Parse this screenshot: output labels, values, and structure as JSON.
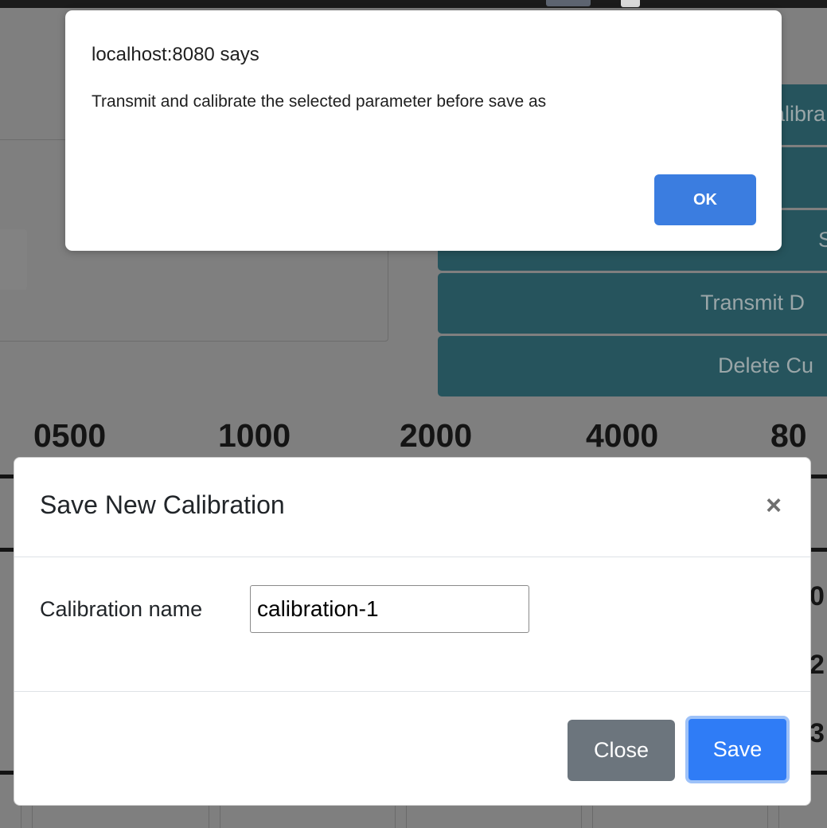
{
  "alert": {
    "title": "localhost:8080 says",
    "message": "Transmit and calibrate the selected parameter before save as",
    "ok_label": "OK"
  },
  "background": {
    "side_buttons": [
      {
        "label": "alibra"
      },
      {
        "label": ""
      },
      {
        "label": "S"
      },
      {
        "label": "Transmit D"
      },
      {
        "label": "Delete Cu"
      }
    ],
    "frequency_headers": [
      "0500",
      "1000",
      "2000",
      "4000",
      "80"
    ],
    "edge_digits": [
      "0",
      "2",
      "3"
    ]
  },
  "modal": {
    "title": "Save New Calibration",
    "close_icon_glyph": "×",
    "field_label": "Calibration name",
    "field_value": "calibration-1",
    "close_label": "Close",
    "save_label": "Save"
  }
}
